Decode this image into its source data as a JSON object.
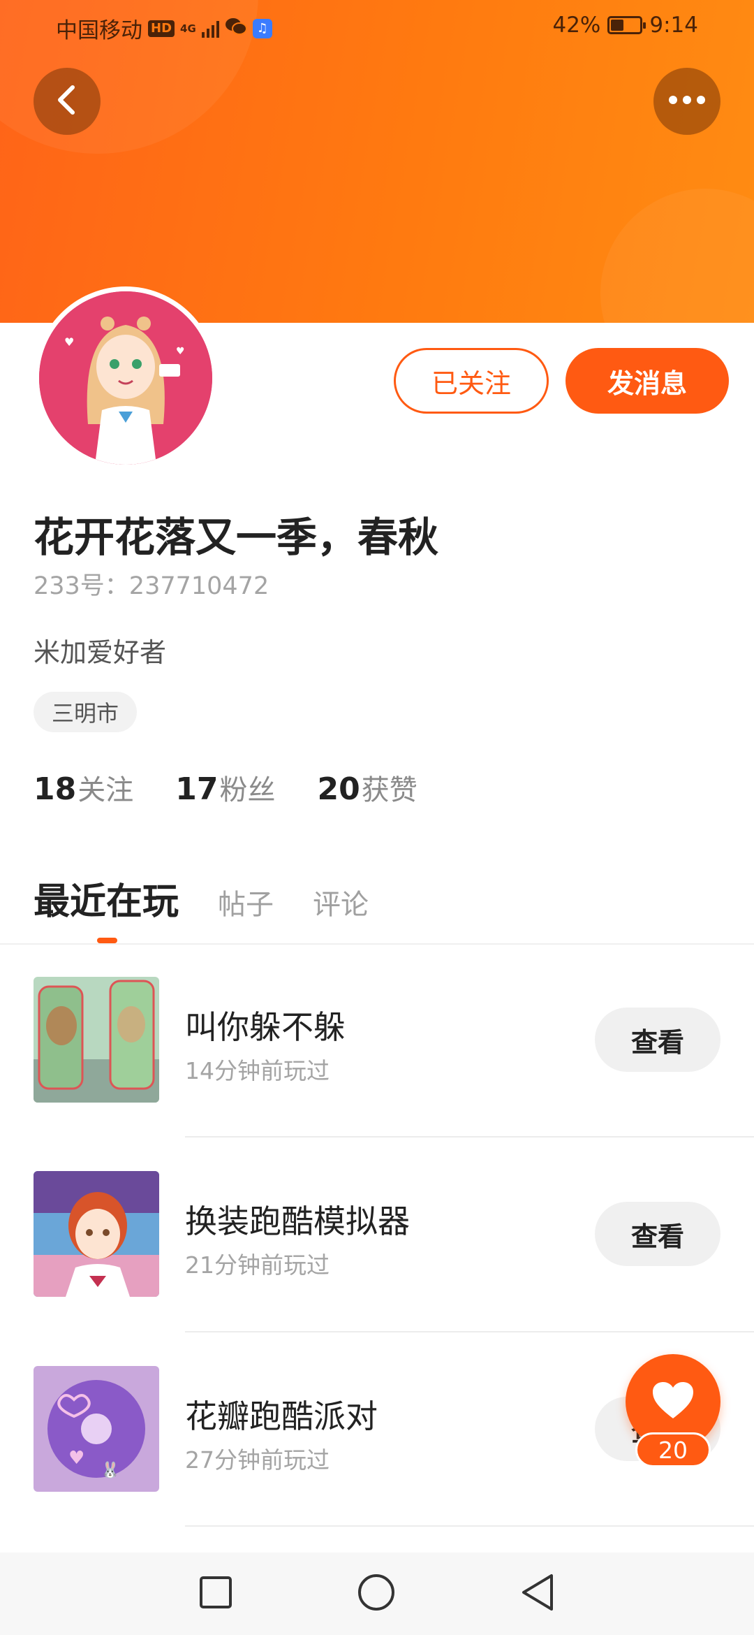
{
  "status_bar": {
    "carrier": "中国移动",
    "hd": "HD",
    "network": "4G",
    "battery": "42%",
    "time": "9:14"
  },
  "header": {
    "back_icon": "chevron-left-icon",
    "more_icon": "more-dots-icon",
    "accent_color": "#ff5a12"
  },
  "profile": {
    "follow_label": "已关注",
    "message_label": "发消息",
    "username": "花开花落又一季，春秋",
    "user_id": "233号：237710472",
    "bio": "米加爱好者",
    "location": "三明市",
    "stats": [
      {
        "num": "18",
        "label": "关注"
      },
      {
        "num": "17",
        "label": "粉丝"
      },
      {
        "num": "20",
        "label": "获赞"
      }
    ]
  },
  "tabs": [
    {
      "label": "最近在玩",
      "active": true
    },
    {
      "label": "帖子",
      "active": false
    },
    {
      "label": "评论",
      "active": false
    }
  ],
  "games": [
    {
      "name": "叫你躲不躲",
      "time": "14分钟前玩过",
      "action": "查看"
    },
    {
      "name": "换装跑酷模拟器",
      "time": "21分钟前玩过",
      "action": "查看"
    },
    {
      "name": "花瓣跑酷派对",
      "time": "27分钟前玩过",
      "action": "查看"
    }
  ],
  "like_fab": {
    "count": "20",
    "icon": "heart-icon"
  },
  "nav_bar": {
    "icons": [
      "square-recent-icon",
      "circle-home-icon",
      "triangle-back-icon"
    ]
  }
}
